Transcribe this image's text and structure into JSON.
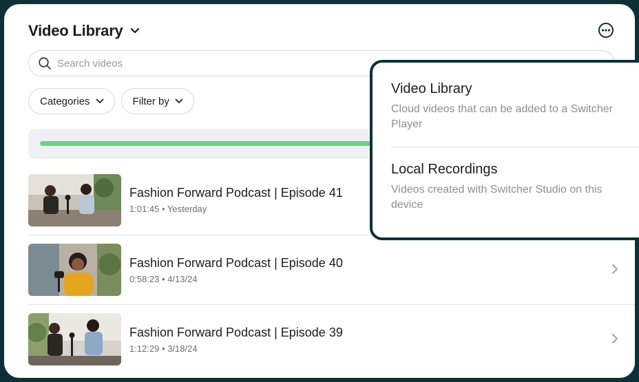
{
  "header": {
    "title": "Video Library",
    "title_chevron_icon": "chevron-down-icon",
    "more_icon": "ellipsis-circle-icon"
  },
  "search": {
    "placeholder": "Search videos",
    "value": ""
  },
  "filters": [
    {
      "label": "Categories"
    },
    {
      "label": "Filter by"
    }
  ],
  "upload_progress": {
    "fraction": 0.57,
    "color": "#6fd18b"
  },
  "videos": [
    {
      "title": "Fashion Forward Podcast | Episode 41",
      "duration": "1:01:45",
      "date": "Yesterday"
    },
    {
      "title": "Fashion Forward Podcast | Episode 40",
      "duration": "0:58:23",
      "date": "4/13/24"
    },
    {
      "title": "Fashion Forward Podcast | Episode 39",
      "duration": "1:12:29",
      "date": "3/18/24"
    }
  ],
  "meta_separator": "•",
  "source_menu": {
    "items": [
      {
        "title": "Video Library",
        "description": "Cloud videos that can be added to a Switcher Player"
      },
      {
        "title": "Local Recordings",
        "description": "Videos created with Switcher Studio on this device"
      }
    ]
  },
  "colors": {
    "frame_border": "#0f2f38",
    "accent_green": "#6fd18b",
    "text_primary": "#1c1c1e",
    "text_secondary": "#6e6e73"
  }
}
